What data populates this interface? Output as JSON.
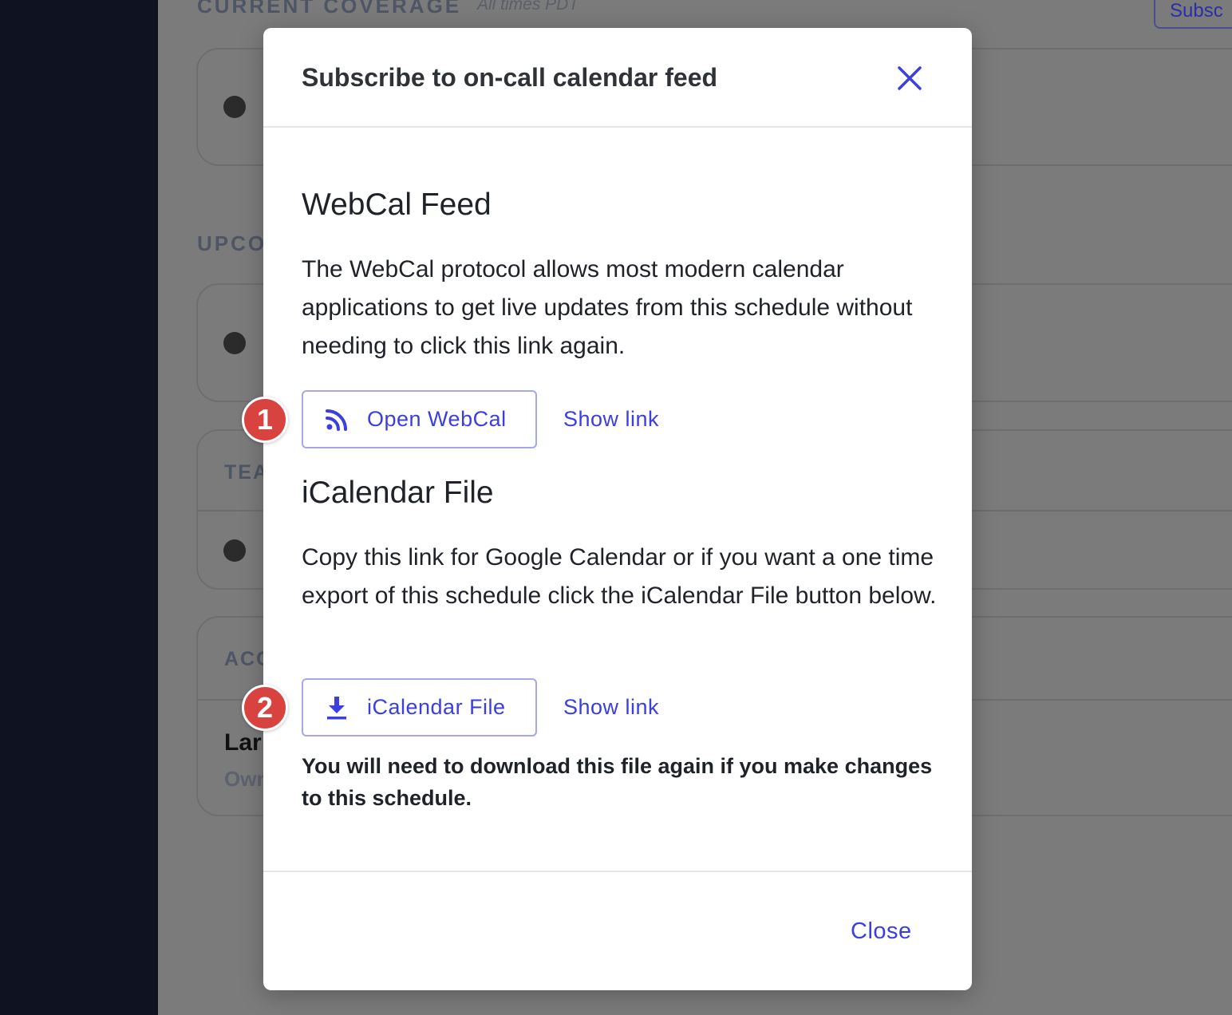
{
  "background": {
    "current_coverage_heading": "CURRENT COVERAGE",
    "timezone_note": "All times PDT",
    "subscribe_button": "Subsc",
    "upcoming_heading": "UPCO",
    "teams_label": "TEA",
    "access_label": "ACC",
    "owner_name": "Lar",
    "owner_role": "Own"
  },
  "modal": {
    "title": "Subscribe to on-call calendar feed",
    "close_icon": "close-x-icon",
    "webcal": {
      "title": "WebCal Feed",
      "description": "The WebCal protocol allows most modern calendar applications to get live updates from this schedule without needing to click this link again.",
      "button_label": "Open WebCal",
      "button_icon": "rss-feed-icon",
      "show_link": "Show link",
      "badge": "1"
    },
    "icalendar": {
      "title": "iCalendar File",
      "description": "Copy this link for Google Calendar or if you want a one time export of this schedule click the iCalendar File button below.",
      "button_label": "iCalendar File",
      "button_icon": "download-icon",
      "show_link": "Show link",
      "badge": "2",
      "warning": "You will need to download this file again if you make changes to this schedule."
    },
    "footer_close": "Close"
  },
  "colors": {
    "accent": "#3b3ee0",
    "badge": "#d9433f",
    "sidebar": "#0f1321",
    "overlay_background": "#7b7b7b"
  }
}
